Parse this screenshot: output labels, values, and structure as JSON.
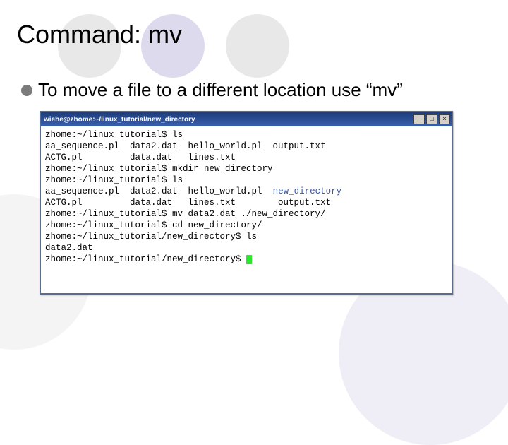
{
  "slide": {
    "title": "Command: mv",
    "bullet": "To move a file to a different location use “mv”"
  },
  "terminal": {
    "title": "wiehe@zhome:~/linux_tutorial/new_directory",
    "controls": {
      "min": "_",
      "max": "□",
      "close": "×"
    },
    "lines": [
      {
        "t": "zhome:~/linux_tutorial$ ls"
      },
      {
        "t": "aa_sequence.pl  data2.dat  hello_world.pl  output.txt"
      },
      {
        "t": "ACTG.pl         data.dat   lines.txt"
      },
      {
        "t": "zhome:~/linux_tutorial$ mkdir new_directory"
      },
      {
        "t": "zhome:~/linux_tutorial$ ls"
      },
      {
        "cols": [
          "aa_sequence.pl  data2.dat  hello_world.pl  ",
          "new_directory"
        ]
      },
      {
        "t": "ACTG.pl         data.dat   lines.txt        output.txt"
      },
      {
        "t": "zhome:~/linux_tutorial$ mv data2.dat ./new_directory/"
      },
      {
        "t": "zhome:~/linux_tutorial$ cd new_directory/"
      },
      {
        "t": "zhome:~/linux_tutorial/new_directory$ ls"
      },
      {
        "t": "data2.dat"
      },
      {
        "t": "zhome:~/linux_tutorial/new_directory$ ",
        "cursor": true
      }
    ]
  }
}
